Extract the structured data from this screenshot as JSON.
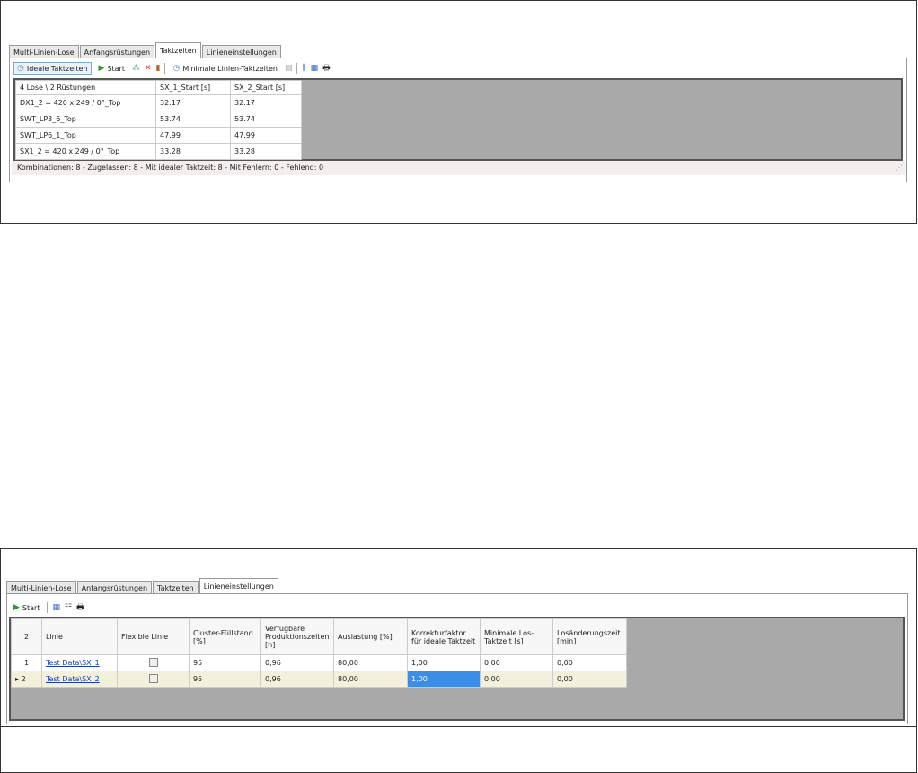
{
  "top": {
    "tabs": [
      "Multi-Linien-Lose",
      "Anfangsrüstungen",
      "Taktzeiten",
      "Linieneinstellungen"
    ],
    "active_tab": 2,
    "toolbar": {
      "ideal": "Ideale Taktzeiten",
      "start": "Start",
      "minimal": "Minimale Linien-Taktzeiten"
    },
    "headers": [
      "4 Lose \\ 2 Rüstungen",
      "SX_1_Start [s]",
      "SX_2_Start [s]"
    ],
    "rows": [
      [
        "DX1_2 = 420 x 249 / 0°_Top",
        "32.17",
        "32.17"
      ],
      [
        "SWT_LP3_6_Top",
        "53.74",
        "53.74"
      ],
      [
        "SWT_LP6_1_Top",
        "47.99",
        "47.99"
      ],
      [
        "SX1_2 = 420 x 249 / 0°_Top",
        "33.28",
        "33.28"
      ]
    ],
    "status": "Kombinationen: 8 - Zugelassen: 8 - Mit idealer Taktzeit: 8 - Mit Fehlern: 0 - Fehlend: 0"
  },
  "bottom": {
    "tabs": [
      "Multi-Linien-Lose",
      "Anfangsrüstungen",
      "Taktzeiten",
      "Linieneinstellungen"
    ],
    "active_tab": 3,
    "toolbar": {
      "start": "Start"
    },
    "headers": [
      "2",
      "Linie",
      "Flexible Linie",
      "Cluster-Füllstand [%]",
      "Verfügbare Produktionszeiten [h]",
      "Auslastung [%]",
      "Korrekturfaktor für ideale Taktzeit",
      "Minimale Los-Taktzeit [s]",
      "Losänderungszeit [min]"
    ],
    "rows": [
      [
        "1",
        "Test Data\\SX_1",
        "",
        "95",
        "0,96",
        "80,00",
        "1,00",
        "0,00",
        "0,00"
      ],
      [
        "2",
        "Test Data\\SX_2",
        "",
        "95",
        "0,96",
        "80,00",
        "1,00",
        "0,00",
        "0,00"
      ]
    ]
  }
}
